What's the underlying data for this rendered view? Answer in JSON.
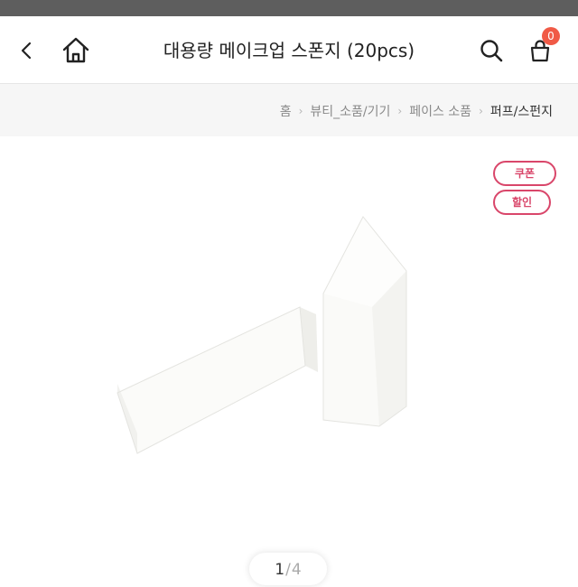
{
  "header": {
    "title": "대용량 메이크업 스폰지 (20pcs)",
    "cart_count": "0"
  },
  "icons": {
    "back": "chevron-left-icon",
    "home": "home-icon",
    "search": "search-icon",
    "cart": "shopping-bag-icon"
  },
  "breadcrumb": [
    {
      "label": "홈"
    },
    {
      "label": "뷰티_소품/기기"
    },
    {
      "label": "페이스 소품"
    },
    {
      "label": "퍼프/스펀지"
    }
  ],
  "tags": {
    "coupon": "쿠폰",
    "sale": "할인"
  },
  "pager": {
    "current": "1",
    "total": "4"
  },
  "colors": {
    "accent": "#d9466a",
    "badge": "#f05a46"
  }
}
